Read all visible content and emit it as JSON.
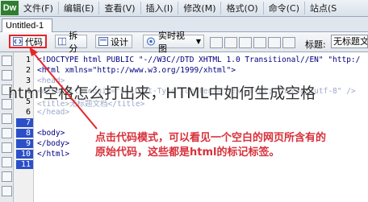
{
  "app": {
    "logo": "Dw"
  },
  "menu": [
    "文件(F)",
    "编辑(E)",
    "查看(V)",
    "插入(I)",
    "修改(M)",
    "格式(O)",
    "命令(C)",
    "站点(S"
  ],
  "tab": {
    "title": "Untitled-1"
  },
  "toolbar": {
    "code_label": "代码",
    "split_label": "拆分",
    "design_label": "设计",
    "live_label": "实时视图",
    "title_label": "标题:",
    "title_value": "无标题文档"
  },
  "line_numbers": [
    "1",
    "2",
    "3",
    "4",
    "5",
    "6",
    "7",
    "8",
    "9",
    "10",
    "11"
  ],
  "code_lines": [
    "<!DOCTYPE html PUBLIC \"-//W3C//DTD XHTML 1.0 Transitional//EN\" \"http:/",
    "<html xmlns=\"http://www.w3.org/1999/xhtml\">",
    "<head>",
    "<meta http-equiv=\"Content-Type\" content=\"text/html; charset=utf-8\" />",
    "<title>无标题文档</title>",
    "</head>",
    "",
    "<body>",
    "</body>",
    "</html>",
    ""
  ],
  "overlay_title": "html空格怎么打出来，HTML中如何生成空格",
  "annotation": {
    "line1": "点击代码模式，可以看见一个空白的网页所含有的",
    "line2": "原始代码，这些都是html的标记标签。"
  },
  "colors": {
    "highlight": "#e4262a",
    "annotation": "#d8303a"
  }
}
